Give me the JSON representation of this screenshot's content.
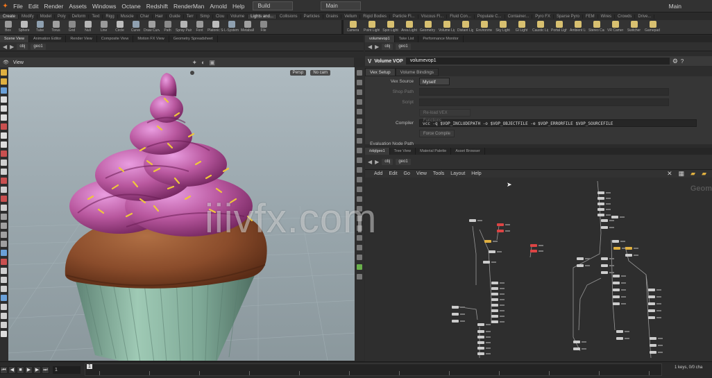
{
  "menu": {
    "items": [
      "File",
      "Edit",
      "Render",
      "Assets",
      "Windows",
      "Octane",
      "Redshift",
      "RenderMan",
      "Arnold",
      "Help"
    ],
    "desktop": "Build",
    "context": "Main",
    "right_label": "Main"
  },
  "shelf": {
    "tabs": [
      "Create",
      "Modify",
      "Model",
      "Poly",
      "Deform",
      "Text",
      "Rigg",
      "Muscle",
      "Char",
      "Hair",
      "Guide",
      "Terr",
      "Simp",
      "Clou",
      "Volume",
      "Lights and...",
      "Collisions",
      "Particles",
      "Grains",
      "Vellum",
      "Rigid Bodies",
      "Particle Fl...",
      "Viscous Fl...",
      "Fluid Con...",
      "Populate C...",
      "Container...",
      "Pyro FX",
      "Sparse Pyro",
      "FEM",
      "Wires",
      "Crowds",
      "Drive..."
    ],
    "tools_left": [
      "Box",
      "Sphere",
      "Tube",
      "Torus",
      "Grid",
      "Null",
      "Line",
      "Circle",
      "Curve",
      "Draw Curve",
      "Path",
      "Spray Paint",
      "Font",
      "Platonic Solids",
      "L-System",
      "Metaball",
      "File"
    ],
    "tools_right": [
      "Camera",
      "Point Light",
      "Spot Light",
      "Area Light",
      "Geometry Light",
      "Volume Light",
      "Distant Light",
      "Environment Light",
      "Sky Light",
      "GI Light",
      "Caustic Light",
      "Portal Light",
      "Ambient Light",
      "Stereo Camera",
      "VR Camera",
      "Switcher",
      "Gamepad Camera"
    ]
  },
  "left_tabs": [
    "Scene View",
    "Animation Editor",
    "Render View",
    "Composite View",
    "Motion FX View",
    "Geometry Spreadsheet"
  ],
  "left_path": [
    "obj",
    "geo1"
  ],
  "viewport": {
    "label": "View",
    "persp": "Persp",
    "cam": "No cam"
  },
  "right_top_tabs": [
    "volumevop1",
    "Take List",
    "Performance Monitor"
  ],
  "right_top_path": [
    "obj",
    "geo1"
  ],
  "node_header": {
    "type": "Volume VOP",
    "name": "volumevop1"
  },
  "param_tabs": [
    "Vex Setup",
    "Volume Bindings"
  ],
  "params": {
    "vex_source_label": "Vex Source",
    "vex_source_value": "Myself",
    "shop_path_label": "Shop Path",
    "script_label": "Script",
    "script_value": "",
    "force_compile_btn": "Force Compile",
    "compiler_label": "Compiler",
    "compiler_value": "vcc -q $VOP_INCLUDEPATH -o $VOP_OBJECTFILE -e $VOP_ERRORFILE $VOP_SOURCEFILE",
    "eval_node_label": "Evaluation Node Path"
  },
  "net_tabs": [
    "/obj/geo1",
    "Tree View",
    "Material Palette",
    "Asset Browser"
  ],
  "net_path": [
    "obj",
    "geo1"
  ],
  "net_menu": [
    "Add",
    "Edit",
    "Go",
    "View",
    "Tools",
    "Layout",
    "Help"
  ],
  "net_badge": "Geom",
  "timeline": {
    "frame": "1",
    "start": "1",
    "end_label": "1 keys, 0/0 cha"
  },
  "watermark": "iiivfx.com"
}
